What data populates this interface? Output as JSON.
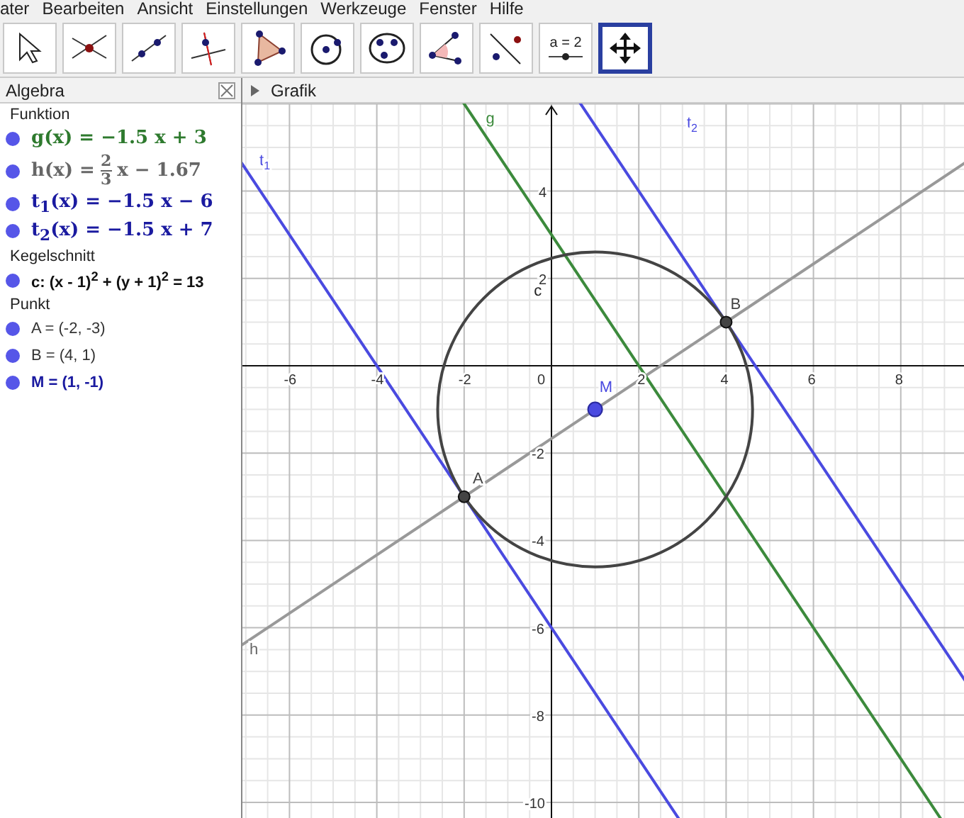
{
  "menu": [
    "ater",
    "Bearbeiten",
    "Ansicht",
    "Einstellungen",
    "Werkzeuge",
    "Fenster",
    "Hilfe"
  ],
  "toolbar": [
    {
      "kind": "pointer",
      "selected": false
    },
    {
      "kind": "intersect",
      "selected": false
    },
    {
      "kind": "line",
      "selected": false
    },
    {
      "kind": "perpendicular",
      "selected": false
    },
    {
      "kind": "polygon",
      "selected": false
    },
    {
      "kind": "circle",
      "selected": false
    },
    {
      "kind": "conic",
      "selected": false
    },
    {
      "kind": "angle",
      "selected": false
    },
    {
      "kind": "reflect",
      "selected": false
    },
    {
      "kind": "slider",
      "label": "a = 2",
      "selected": false
    },
    {
      "kind": "move",
      "selected": true
    }
  ],
  "algebra": {
    "title": "Algebra",
    "groups": [
      {
        "heading": "Funktion",
        "items": [
          {
            "kind": "formula",
            "text": "g(x) = −1.5 x + 3",
            "color": "#2e7a2e"
          },
          {
            "kind": "fraction",
            "prefix": "h(x) =",
            "numerator": "2",
            "denominator": "3",
            "suffix": "x − 1.67",
            "color": "#666666"
          },
          {
            "kind": "formula",
            "text": "t$_{1}$(x) = −1.5 x − 6",
            "color": "#1a1aa0"
          },
          {
            "kind": "formula",
            "text": "t$_{2}$(x) = −1.5 x + 7",
            "color": "#1a1aa0"
          }
        ]
      },
      {
        "heading": "Kegelschnitt",
        "items": [
          {
            "kind": "plain",
            "text": "c: (x - 1)$^{2}$ + (y + 1)$^{2}$ = 13",
            "color": "#111111"
          }
        ]
      },
      {
        "heading": "Punkt",
        "items": [
          {
            "kind": "plain",
            "text": "A = (-2, -3)",
            "color": "#333333"
          },
          {
            "kind": "plain",
            "text": "B = (4, 1)",
            "color": "#333333"
          },
          {
            "kind": "plain",
            "text": "M = (1, -1)",
            "color": "#1a1aa0"
          }
        ]
      }
    ]
  },
  "graphics": {
    "title": "Grafik",
    "x_ticks": [
      "-6",
      "-4",
      "-2",
      "0",
      "2",
      "4",
      "6",
      "8"
    ],
    "y_ticks": [
      "4",
      "2",
      "-2",
      "-4",
      "-6",
      "-8",
      "-10"
    ],
    "labels": {
      "g": "g",
      "t2": "t$_{2}$",
      "t1": "t$_{1}$",
      "c": "c",
      "B": "B",
      "M": "M",
      "A": "A",
      "h": "h"
    }
  }
}
